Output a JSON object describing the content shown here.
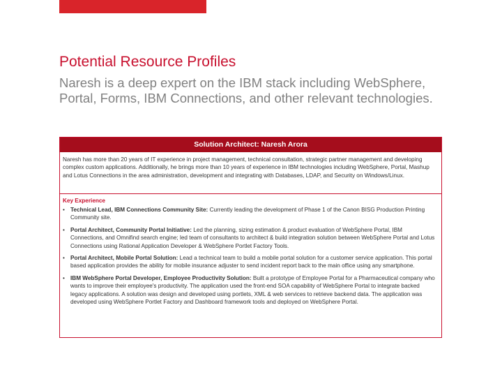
{
  "slide": {
    "title": "Potential Resource Profiles",
    "subtitle": "Naresh is a deep expert on the IBM stack including WebSphere, Portal, Forms, IBM Connections, and other relevant technologies.",
    "colors": {
      "accent": "#d9242a",
      "header_bg": "#a50d1c",
      "title": "#c8102e",
      "subtitle": "#808080"
    }
  },
  "card": {
    "header": "Solution Architect:  Naresh Arora",
    "summary": "Naresh has more than 20 years of IT experience in project management, technical consultation, strategic partner management and developing complex custom applications.  Additionally, he brings more than 10 years of experience in IBM technologies including WebSphere, Portal, Mashup and Lotus Connections in the area administration, development and integrating with Databases, LDAP, and Security on Windows/Linux.",
    "section_label": "Key Experience",
    "bullet": "•",
    "experience": [
      {
        "role": "Technical Lead, IBM Connections Community Site:",
        "text": "Currently leading the development of Phase 1 of the Canon BISG Production Printing Community site."
      },
      {
        "role": "Portal Architect, Community Portal Initiative:",
        "text": "Led the planning,  sizing estimation & product evaluation of WebSphere Portal, IBM Connections, and Omnifind search engine; led team of consultants to architect & build integration solution between WebSphere Portal and Lotus Connections using Rational Application Developer & WebSphere Portlet Factory Tools."
      },
      {
        "role": "Portal Architect, Mobile Portal Solution:",
        "text": "Lead a technical team to build a mobile portal solution for a customer service application. This portal based application provides the ability for mobile insurance adjuster to send incident report back to the main office using any smartphone."
      },
      {
        "role": "IBM WebSphere Portal Developer, Employee  Productivity Solution:",
        "text": "Built a prototype of Employee Portal for a Pharmaceutical company who wants to improve their employee's productivity.  The application used the front-end SOA capability of WebSphere Portal to integrate backed legacy applications.  A solution was design and developed using portlets, XML & web services to retrieve backend data.  The application was developed using WebSphere Portlet Factory and Dashboard framework tools and deployed on WebSphere Portal."
      }
    ]
  }
}
